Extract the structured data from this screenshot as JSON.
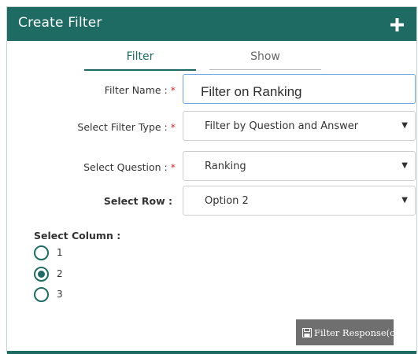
{
  "header": {
    "title": "Create Filter",
    "add_icon": "plus-icon"
  },
  "tabs": [
    {
      "label": "Filter",
      "active": true
    },
    {
      "label": "Show",
      "active": false
    }
  ],
  "form": {
    "filter_name": {
      "label": "Filter Name :",
      "required_mark": "*",
      "value": "Filter on Ranking"
    },
    "filter_type": {
      "label": "Select Filter Type :",
      "required_mark": "*",
      "value": "Filter by Question and Answer"
    },
    "question": {
      "label": "Select Question :",
      "required_mark": "*",
      "value": "Ranking"
    },
    "row": {
      "label": "Select Row :",
      "value": "Option 2"
    }
  },
  "column": {
    "label": "Select Column :",
    "options": [
      {
        "label": "1",
        "selected": false
      },
      {
        "label": "2",
        "selected": true
      },
      {
        "label": "3",
        "selected": false
      }
    ]
  },
  "actions": {
    "filter_response_label": "Filter Response(c)",
    "icon": "save-icon"
  },
  "colors": {
    "primary": "#1e6b63",
    "required": "#d52b2b",
    "button": "#6f6f6f",
    "input_focus": "#6aa4e6"
  }
}
